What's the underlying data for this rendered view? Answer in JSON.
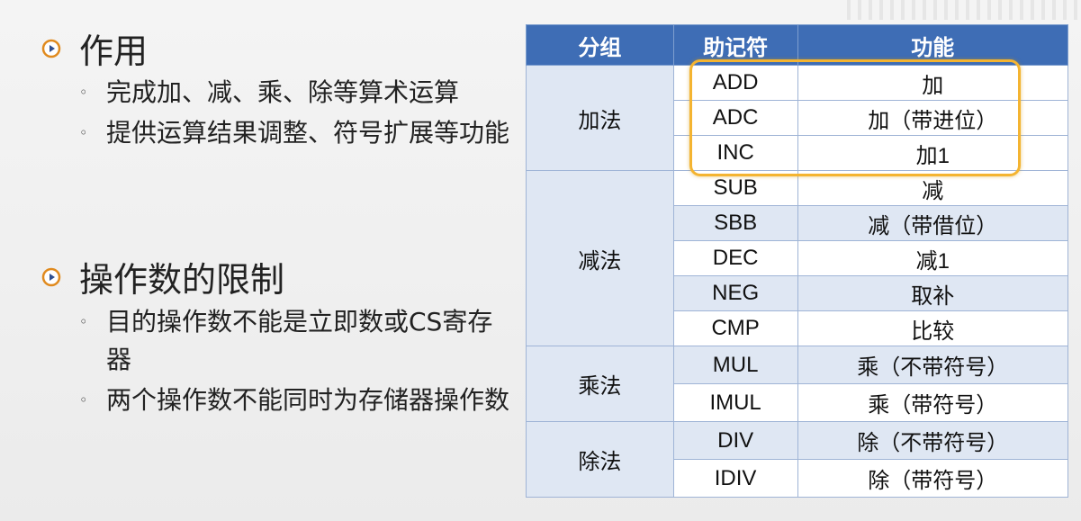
{
  "left": {
    "sections": [
      {
        "title": "作用",
        "items": [
          "完成加、减、乘、除等算术运算",
          "提供运算结果调整、符号扩展等功能"
        ]
      },
      {
        "title": "操作数的限制",
        "items": [
          "目的操作数不能是立即数或CS寄存器",
          "两个操作数不能同时为存储器操作数"
        ]
      }
    ],
    "sub_bullet": "◦"
  },
  "table": {
    "headers": [
      "分组",
      "助记符",
      "功能"
    ],
    "groups": [
      {
        "name": "加法",
        "rows": [
          [
            "ADD",
            "加"
          ],
          [
            "ADC",
            "加（带进位）"
          ],
          [
            "INC",
            "加1"
          ]
        ]
      },
      {
        "name": "减法",
        "rows": [
          [
            "SUB",
            "减"
          ],
          [
            "SBB",
            "减（带借位）"
          ],
          [
            "DEC",
            "减1"
          ],
          [
            "NEG",
            "取补"
          ],
          [
            "CMP",
            "比较"
          ]
        ]
      },
      {
        "name": "乘法",
        "rows": [
          [
            "MUL",
            "乘（不带符号）"
          ],
          [
            "IMUL",
            "乘（带符号）"
          ]
        ]
      },
      {
        "name": "除法",
        "rows": [
          [
            "DIV",
            "除（不带符号）"
          ],
          [
            "IDIV",
            "除（带符号）"
          ]
        ]
      }
    ],
    "highlight_color": "#f4b431",
    "header_color": "#3e6db5"
  }
}
